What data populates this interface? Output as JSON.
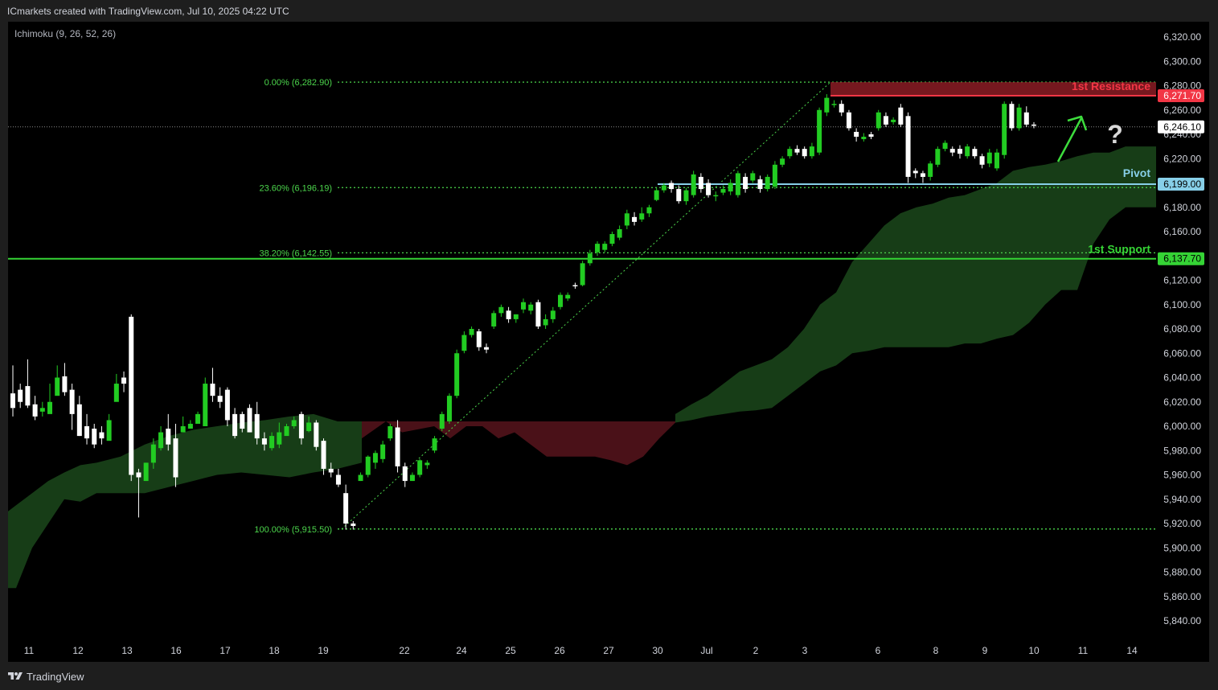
{
  "header": {
    "credit": "ICmarkets created with TradingView.com, Jul 10, 2025 04:22 UTC",
    "indicator": "Ichimoku (9, 26, 52, 26)"
  },
  "footer": {
    "brand": "TradingView"
  },
  "colors": {
    "background": "#000000",
    "frame": "#1e1e1e",
    "bull_candle": "#22cc22",
    "bear_candle": "#ffffff",
    "cloud_bull": "#173d17",
    "cloud_bear": "#4a1118",
    "fib_line": "#4cd64c",
    "resistance": "#f23645",
    "support": "#35d435",
    "pivot": "#87cfe8",
    "last_price": "#ffffff"
  },
  "chart_data": {
    "type": "candlestick",
    "price_axis_ticks": [
      "6,320.00",
      "6,300.00",
      "6,280.00",
      "6,260.00",
      "6,240.00",
      "6,220.00",
      "6,200.00",
      "6,180.00",
      "6,160.00",
      "6,140.00",
      "6,120.00",
      "6,100.00",
      "6,080.00",
      "6,060.00",
      "6,040.00",
      "6,020.00",
      "6,000.00",
      "5,980.00",
      "5,960.00",
      "5,940.00",
      "5,920.00",
      "5,900.00",
      "5,880.00",
      "5,860.00",
      "5,840.00"
    ],
    "price_axis_values": [
      6320,
      6300,
      6280,
      6260,
      6240,
      6220,
      6200,
      6180,
      6160,
      6140,
      6120,
      6100,
      6080,
      6060,
      6040,
      6020,
      6000,
      5980,
      5960,
      5940,
      5920,
      5900,
      5880,
      5860,
      5840
    ],
    "ylim": [
      5828,
      6346
    ],
    "time_axis_labels": [
      "11",
      "12",
      "13",
      "16",
      "17",
      "18",
      "19",
      "22",
      "24",
      "25",
      "26",
      "27",
      "30",
      "Jul",
      "2",
      "3",
      "6",
      "8",
      "9",
      "10",
      "11",
      "14"
    ],
    "levels": {
      "resistance": {
        "label": "1st Resistance",
        "value": 6271.7,
        "tag": "6,271.70"
      },
      "pivot": {
        "label": "Pivot",
        "value": 6199.0,
        "tag": "6,199.00"
      },
      "support": {
        "label": "1st Support",
        "value": 6137.7,
        "tag": "6,137.70"
      },
      "last_price": {
        "value": 6246.1,
        "tag": "6,246.10"
      }
    },
    "fibonacci": [
      {
        "label": "0.00% (6,282.90)",
        "value": 6282.9
      },
      {
        "label": "23.60% (6,196.19)",
        "value": 6196.19
      },
      {
        "label": "38.20% (6,142.55)",
        "value": 6142.55
      },
      {
        "label": "100.00% (5,915.50)",
        "value": 5915.5
      }
    ],
    "annotations": {
      "question_mark": "?"
    },
    "candles_open_close": [
      [
        6027,
        6015
      ],
      [
        6030,
        6020
      ],
      [
        6033,
        6017
      ],
      [
        6018,
        6008
      ],
      [
        6012,
        6015
      ],
      [
        6010,
        6020
      ],
      [
        6025,
        6040
      ],
      [
        6041,
        6028
      ],
      [
        6030,
        6010
      ],
      [
        6018,
        5992
      ],
      [
        6000,
        5990
      ],
      [
        5998,
        5985
      ],
      [
        5995,
        5990
      ],
      [
        5988,
        6005
      ],
      [
        6020,
        6035
      ],
      [
        6040,
        6035
      ],
      [
        6090,
        5960
      ],
      [
        5962,
        5958
      ],
      [
        5955,
        5970
      ],
      [
        5970,
        5985
      ],
      [
        5982,
        5995
      ],
      [
        5998,
        5985
      ],
      [
        5990,
        5958
      ],
      [
        5995,
        6000
      ],
      [
        5998,
        6002
      ],
      [
        6002,
        6010
      ],
      [
        6000,
        6035
      ],
      [
        6035,
        6025
      ],
      [
        6025,
        6020
      ],
      [
        6030,
        6005
      ],
      [
        6010,
        5992
      ],
      [
        6010,
        5998
      ],
      [
        6015,
        5995
      ],
      [
        6010,
        5990
      ],
      [
        5990,
        5985
      ],
      [
        5982,
        5992
      ],
      [
        5985,
        5995
      ],
      [
        5992,
        6000
      ],
      [
        6000,
        6005
      ],
      [
        6010,
        5990
      ],
      [
        5996,
        6003
      ],
      [
        6003,
        5983
      ],
      [
        5988,
        5965
      ],
      [
        5965,
        5962
      ],
      [
        5960,
        5952
      ],
      [
        5945,
        5920
      ],
      [
        5920,
        5918
      ],
      [
        5955,
        5960
      ],
      [
        5960,
        5975
      ],
      [
        5970,
        5978
      ],
      [
        5973,
        5985
      ],
      [
        5990,
        6000
      ],
      [
        5999,
        5967
      ],
      [
        5967,
        5955
      ],
      [
        5955,
        5960
      ],
      [
        5960,
        5972
      ],
      [
        5968,
        5970
      ],
      [
        5980,
        5990
      ],
      [
        5998,
        6010
      ],
      [
        6004,
        6025
      ],
      [
        6025,
        6060
      ],
      [
        6062,
        6075
      ],
      [
        6075,
        6080
      ],
      [
        6078,
        6065
      ],
      [
        6065,
        6063
      ],
      [
        6082,
        6093
      ],
      [
        6093,
        6098
      ],
      [
        6095,
        6088
      ],
      [
        6088,
        6092
      ],
      [
        6096,
        6102
      ],
      [
        6095,
        6100
      ],
      [
        6102,
        6082
      ],
      [
        6083,
        6088
      ],
      [
        6088,
        6095
      ],
      [
        6098,
        6108
      ],
      [
        6105,
        6108
      ],
      [
        6116,
        6115
      ],
      [
        6116,
        6134
      ],
      [
        6134,
        6142
      ],
      [
        6143,
        6150
      ],
      [
        6145,
        6150
      ],
      [
        6150,
        6158
      ],
      [
        6155,
        6162
      ],
      [
        6165,
        6175
      ],
      [
        6172,
        6168
      ],
      [
        6170,
        6175
      ],
      [
        6175,
        6180
      ],
      [
        6186,
        6194
      ],
      [
        6194,
        6198
      ],
      [
        6200,
        6195
      ],
      [
        6195,
        6185
      ],
      [
        6185,
        6194
      ],
      [
        6190,
        6207
      ],
      [
        6205,
        6195
      ],
      [
        6200,
        6190
      ],
      [
        6190,
        6190
      ],
      [
        6192,
        6195
      ],
      [
        6193,
        6200
      ],
      [
        6190,
        6208
      ],
      [
        6205,
        6195
      ],
      [
        6202,
        6208
      ],
      [
        6203,
        6195
      ],
      [
        6195,
        6205
      ],
      [
        6197,
        6215
      ],
      [
        6215,
        6220
      ],
      [
        6222,
        6228
      ],
      [
        6228,
        6225
      ],
      [
        6228,
        6222
      ],
      [
        6222,
        6230
      ],
      [
        6225,
        6260
      ],
      [
        6258,
        6270
      ],
      [
        6265,
        6265
      ],
      [
        6265,
        6258
      ],
      [
        6258,
        6245
      ],
      [
        6242,
        6238
      ],
      [
        6236,
        6238
      ],
      [
        6240,
        6238
      ],
      [
        6245,
        6258
      ],
      [
        6255,
        6248
      ],
      [
        6250,
        6252
      ],
      [
        6262,
        6248
      ],
      [
        6255,
        6205
      ],
      [
        6210,
        6208
      ],
      [
        6208,
        6205
      ],
      [
        6205,
        6216
      ],
      [
        6215,
        6228
      ],
      [
        6228,
        6233
      ],
      [
        6228,
        6225
      ],
      [
        6228,
        6224
      ],
      [
        6222,
        6230
      ],
      [
        6228,
        6222
      ],
      [
        6222,
        6215
      ],
      [
        6216,
        6225
      ],
      [
        6212,
        6225
      ],
      [
        6223,
        6265
      ],
      [
        6265,
        6245
      ],
      [
        6245,
        6262
      ],
      [
        6258,
        6248
      ],
      [
        6248,
        6247
      ]
    ],
    "candle_ranges": [
      [
        6050,
        6008
      ],
      [
        6035,
        6015
      ],
      [
        6055,
        6015
      ],
      [
        6025,
        6005
      ],
      [
        6020,
        6008
      ],
      [
        6035,
        6018
      ],
      [
        6050,
        6035
      ],
      [
        6052,
        6025
      ],
      [
        6035,
        5997
      ],
      [
        6025,
        5992
      ],
      [
        6010,
        5985
      ],
      [
        6002,
        5982
      ],
      [
        6000,
        5985
      ],
      [
        6010,
        5990
      ],
      [
        6043,
        6030
      ],
      [
        6045,
        6028
      ],
      [
        6092,
        5955
      ],
      [
        5965,
        5925
      ],
      [
        5970,
        5955
      ],
      [
        5990,
        5965
      ],
      [
        6000,
        5980
      ],
      [
        6010,
        5980
      ],
      [
        6002,
        5950
      ],
      [
        6008,
        5995
      ],
      [
        6005,
        5998
      ],
      [
        6012,
        6005
      ],
      [
        6040,
        6000
      ],
      [
        6048,
        6020
      ],
      [
        6032,
        6015
      ],
      [
        6032,
        6000
      ],
      [
        6015,
        5990
      ],
      [
        6012,
        5995
      ],
      [
        6018,
        5995
      ],
      [
        6020,
        5985
      ],
      [
        5995,
        5980
      ],
      [
        5995,
        5980
      ],
      [
        6003,
        5982
      ],
      [
        6002,
        5995
      ],
      [
        6008,
        5998
      ],
      [
        6012,
        5985
      ],
      [
        6008,
        5995
      ],
      [
        6005,
        5980
      ],
      [
        5990,
        5960
      ],
      [
        5970,
        5958
      ],
      [
        5965,
        5950
      ],
      [
        5952,
        5915
      ],
      [
        5922,
        5915
      ],
      [
        5962,
        5955
      ],
      [
        5976,
        5958
      ],
      [
        5980,
        5965
      ],
      [
        5988,
        5970
      ],
      [
        6002,
        5988
      ],
      [
        6005,
        5962
      ],
      [
        5970,
        5950
      ],
      [
        5962,
        5955
      ],
      [
        5973,
        5958
      ],
      [
        5972,
        5965
      ],
      [
        5992,
        5978
      ],
      [
        6012,
        5996
      ],
      [
        6027,
        6002
      ],
      [
        6063,
        6023
      ],
      [
        6078,
        6060
      ],
      [
        6082,
        6073
      ],
      [
        6080,
        6062
      ],
      [
        6068,
        6060
      ],
      [
        6095,
        6080
      ],
      [
        6100,
        6090
      ],
      [
        6098,
        6085
      ],
      [
        6092,
        6085
      ],
      [
        6105,
        6093
      ],
      [
        6102,
        6092
      ],
      [
        6104,
        6080
      ],
      [
        6092,
        6080
      ],
      [
        6098,
        6085
      ],
      [
        6110,
        6096
      ],
      [
        6110,
        6103
      ],
      [
        6118,
        6113
      ],
      [
        6136,
        6115
      ],
      [
        6145,
        6132
      ],
      [
        6152,
        6140
      ],
      [
        6152,
        6143
      ],
      [
        6160,
        6148
      ],
      [
        6165,
        6153
      ],
      [
        6178,
        6162
      ],
      [
        6176,
        6165
      ],
      [
        6180,
        6168
      ],
      [
        6182,
        6172
      ],
      [
        6196,
        6185
      ],
      [
        6200,
        6192
      ],
      [
        6202,
        6192
      ],
      [
        6198,
        6183
      ],
      [
        6196,
        6182
      ],
      [
        6210,
        6188
      ],
      [
        6208,
        6192
      ],
      [
        6203,
        6188
      ],
      [
        6193,
        6185
      ],
      [
        6198,
        6190
      ],
      [
        6203,
        6190
      ],
      [
        6210,
        6188
      ],
      [
        6208,
        6192
      ],
      [
        6210,
        6200
      ],
      [
        6206,
        6192
      ],
      [
        6207,
        6193
      ],
      [
        6218,
        6195
      ],
      [
        6222,
        6213
      ],
      [
        6230,
        6220
      ],
      [
        6231,
        6223
      ],
      [
        6230,
        6220
      ],
      [
        6233,
        6220
      ],
      [
        6262,
        6223
      ],
      [
        6273,
        6255
      ],
      [
        6268,
        6262
      ],
      [
        6268,
        6255
      ],
      [
        6260,
        6243
      ],
      [
        6245,
        6234
      ],
      [
        6241,
        6234
      ],
      [
        6242,
        6236
      ],
      [
        6260,
        6243
      ],
      [
        6258,
        6246
      ],
      [
        6254,
        6248
      ],
      [
        6265,
        6246
      ],
      [
        6258,
        6200
      ],
      [
        6212,
        6204
      ],
      [
        6210,
        6200
      ],
      [
        6218,
        6202
      ],
      [
        6230,
        6213
      ],
      [
        6235,
        6226
      ],
      [
        6230,
        6222
      ],
      [
        6231,
        6220
      ],
      [
        6232,
        6220
      ],
      [
        6230,
        6220
      ],
      [
        6224,
        6212
      ],
      [
        6228,
        6213
      ],
      [
        6228,
        6210
      ],
      [
        6267,
        6220
      ],
      [
        6267,
        6243
      ],
      [
        6265,
        6243
      ],
      [
        6263,
        6246
      ],
      [
        6250,
        6245
      ]
    ]
  }
}
